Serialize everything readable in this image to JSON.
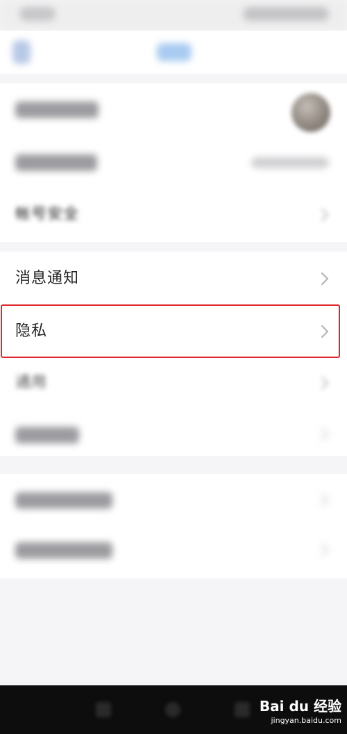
{
  "settings": {
    "account_security_label": "帐号安全",
    "notifications_label": "消息通知",
    "privacy_label": "隐私",
    "general_label": "通用"
  },
  "watermark": {
    "brand": "Bai du 经验",
    "url": "jingyan.baidu.com"
  },
  "highlight": {
    "color": "#e0262a",
    "target": "privacy"
  },
  "icons": {
    "row_arrow": "chevron-right-icon",
    "back": "back-arrow-icon"
  }
}
